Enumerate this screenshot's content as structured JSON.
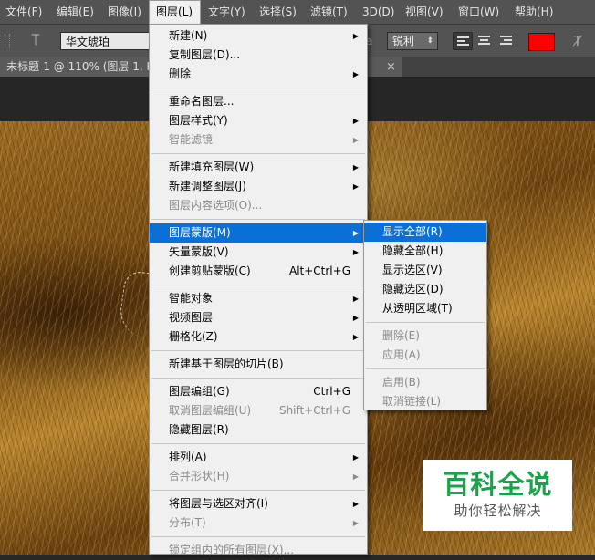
{
  "menubar": {
    "items": [
      {
        "label": "文件(F)"
      },
      {
        "label": "编辑(E)"
      },
      {
        "label": "图像(I)"
      },
      {
        "label": "图层(L)"
      },
      {
        "label": "文字(Y)"
      },
      {
        "label": "选择(S)"
      },
      {
        "label": "滤镜(T)"
      },
      {
        "label": "3D(D)"
      },
      {
        "label": "视图(V)"
      },
      {
        "label": "窗口(W)"
      },
      {
        "label": "帮助(H)"
      }
    ]
  },
  "options": {
    "font_family": "华文琥珀",
    "aa_label": "a",
    "antialias": "锐利",
    "text_color": "#ff0000"
  },
  "document": {
    "tab_title": "未标题-1 @ 110% (图层 1, R",
    "tab_suffix": "#)",
    "close": "×"
  },
  "layer_menu": {
    "items": [
      {
        "label": "新建(N)",
        "arrow": true
      },
      {
        "label": "复制图层(D)..."
      },
      {
        "label": "删除",
        "arrow": true
      },
      {
        "sep": true
      },
      {
        "label": "重命名图层..."
      },
      {
        "label": "图层样式(Y)",
        "arrow": true
      },
      {
        "label": "智能滤镜",
        "arrow": true,
        "disabled": true
      },
      {
        "sep": true
      },
      {
        "label": "新建填充图层(W)",
        "arrow": true
      },
      {
        "label": "新建调整图层(J)",
        "arrow": true
      },
      {
        "label": "图层内容选项(O)...",
        "disabled": true
      },
      {
        "sep": true
      },
      {
        "label": "图层蒙版(M)",
        "arrow": true,
        "highlighted": true
      },
      {
        "label": "矢量蒙版(V)",
        "arrow": true
      },
      {
        "label": "创建剪贴蒙版(C)",
        "shortcut": "Alt+Ctrl+G"
      },
      {
        "sep": true
      },
      {
        "label": "智能对象",
        "arrow": true
      },
      {
        "label": "视频图层",
        "arrow": true
      },
      {
        "label": "栅格化(Z)",
        "arrow": true
      },
      {
        "sep": true
      },
      {
        "label": "新建基于图层的切片(B)"
      },
      {
        "sep": true
      },
      {
        "label": "图层编组(G)",
        "shortcut": "Ctrl+G"
      },
      {
        "label": "取消图层编组(U)",
        "shortcut": "Shift+Ctrl+G",
        "disabled": true
      },
      {
        "label": "隐藏图层(R)"
      },
      {
        "sep": true
      },
      {
        "label": "排列(A)",
        "arrow": true
      },
      {
        "label": "合并形状(H)",
        "arrow": true,
        "disabled": true
      },
      {
        "sep": true
      },
      {
        "label": "将图层与选区对齐(I)",
        "arrow": true
      },
      {
        "label": "分布(T)",
        "arrow": true,
        "disabled": true
      },
      {
        "sep": true
      },
      {
        "label": "锁定组内的所有图层(X)...",
        "disabled": true
      }
    ]
  },
  "mask_submenu": {
    "items": [
      {
        "label": "显示全部(R)",
        "highlighted": true
      },
      {
        "label": "隐藏全部(H)"
      },
      {
        "label": "显示选区(V)"
      },
      {
        "label": "隐藏选区(D)"
      },
      {
        "label": "从透明区域(T)"
      },
      {
        "sep": true
      },
      {
        "label": "删除(E)",
        "disabled": true
      },
      {
        "label": "应用(A)",
        "disabled": true
      },
      {
        "sep": true
      },
      {
        "label": "启用(B)",
        "disabled": true
      },
      {
        "label": "取消链接(L)",
        "disabled": true
      }
    ]
  },
  "watermark": {
    "title": "百科全说",
    "subtitle": "助你轻松解决"
  }
}
